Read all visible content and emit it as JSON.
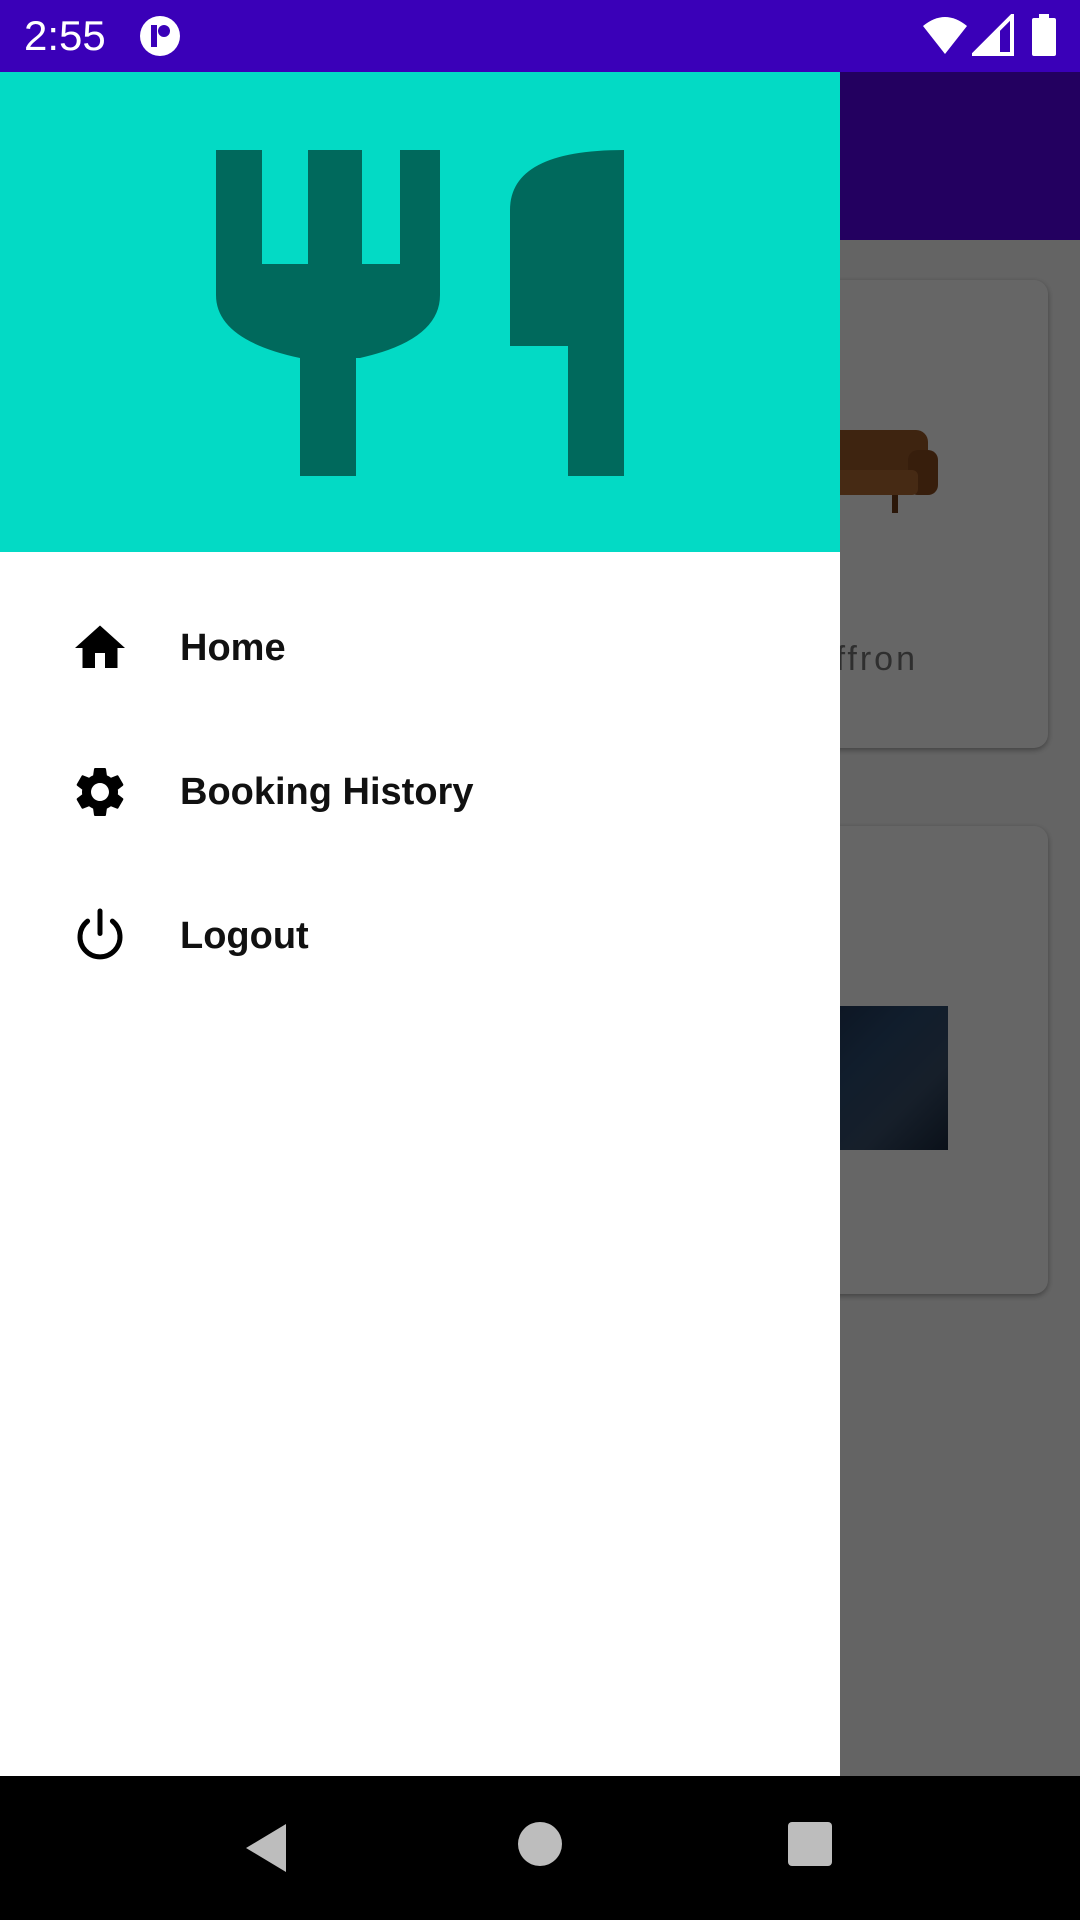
{
  "status_bar": {
    "time": "2:55",
    "icons": [
      "app-notification-icon",
      "wifi-icon",
      "signal-icon",
      "battery-icon"
    ]
  },
  "background_screen": {
    "card_1_title_fragment": "ffron"
  },
  "drawer": {
    "header_icon": "restaurant-icon",
    "items": [
      {
        "label": "Home",
        "icon": "home-icon"
      },
      {
        "label": "Booking History",
        "icon": "gear-icon"
      },
      {
        "label": "Logout",
        "icon": "power-icon"
      }
    ]
  },
  "navigation_bar": {
    "buttons": [
      "back-icon",
      "home-circle-icon",
      "recents-icon"
    ]
  },
  "colors": {
    "status_bar": "#3A00B8",
    "drawer_header": "#03DAC5",
    "logo": "#00695C",
    "toolbar": "#5800F0"
  }
}
